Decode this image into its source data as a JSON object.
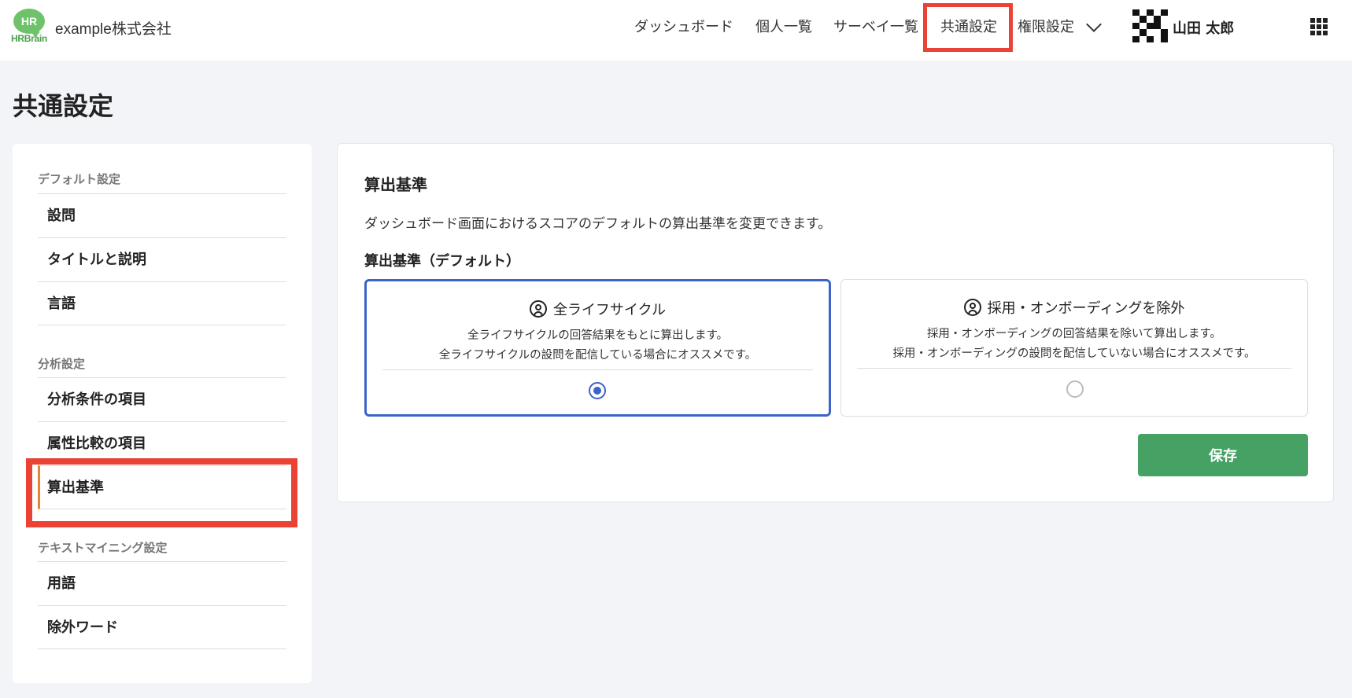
{
  "header": {
    "logo_text": "HR",
    "logo_word": "HRBrain",
    "company": "example株式会社",
    "nav": [
      {
        "label": "ダッシュボード"
      },
      {
        "label": "個人一覧"
      },
      {
        "label": "サーベイ一覧"
      },
      {
        "label": "共通設定"
      },
      {
        "label": "権限設定"
      }
    ],
    "user_name": "山田 太郎"
  },
  "page": {
    "title": "共通設定"
  },
  "sidebar": {
    "sections": [
      {
        "title": "デフォルト設定",
        "items": [
          "設問",
          "タイトルと説明",
          "言語"
        ]
      },
      {
        "title": "分析設定",
        "items": [
          "分析条件の項目",
          "属性比較の項目",
          "算出基準"
        ]
      },
      {
        "title": "テキストマイニング設定",
        "items": [
          "用語",
          "除外ワード"
        ]
      }
    ],
    "active_item": "算出基準"
  },
  "main": {
    "title": "算出基準",
    "description": "ダッシュボード画面におけるスコアのデフォルトの算出基準を変更できます。",
    "field_label": "算出基準（デフォルト）",
    "options": [
      {
        "title": "全ライフサイクル",
        "desc1": "全ライフサイクルの回答結果をもとに算出します。",
        "desc2": "全ライフサイクルの設問を配信している場合にオススメです。",
        "selected": true
      },
      {
        "title": "採用・オンボーディングを除外",
        "desc1": "採用・オンボーディングの回答結果を除いて算出します。",
        "desc2": "採用・オンボーディングの設問を配信していない場合にオススメです。",
        "selected": false
      }
    ],
    "save_label": "保存"
  },
  "colors": {
    "accent": "#3d63c9",
    "save_button": "#46a164",
    "highlight": "#ea4335",
    "active_marker": "#e8822c"
  }
}
